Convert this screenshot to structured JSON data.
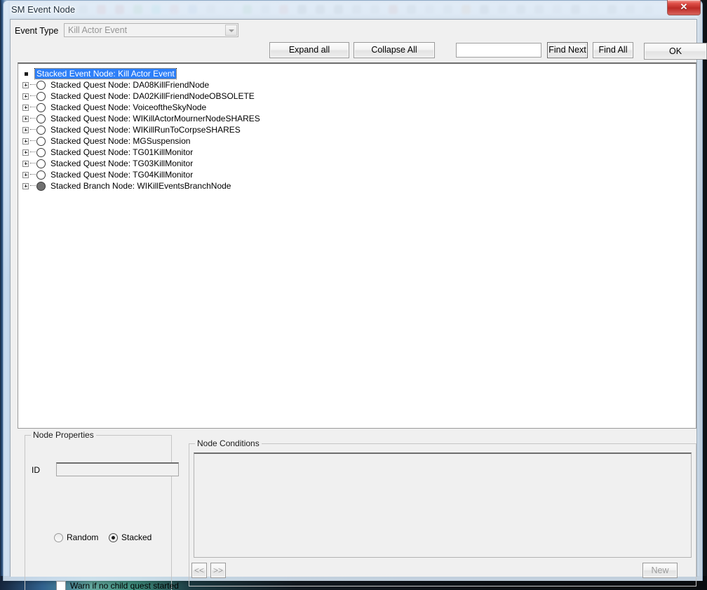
{
  "window": {
    "title": "SM Event Node",
    "close_label": "✕"
  },
  "toolbar": {
    "event_type_label": "Event Type",
    "event_type_value": "Kill Actor Event",
    "expand_all_label": "Expand all",
    "collapse_all_label": "Collapse All",
    "find_input_value": "",
    "find_input_placeholder": "",
    "find_next_label": "Find Next",
    "find_all_label": "Find All",
    "ok_label": "OK"
  },
  "tree": {
    "rows": [
      {
        "label": "Stacked Event Node: Kill Actor Event",
        "kind": "root",
        "selected": true
      },
      {
        "label": "Stacked Quest Node: DA08KillFriendNode",
        "kind": "quest",
        "selected": false
      },
      {
        "label": "Stacked Quest Node: DA02KillFriendNodeOBSOLETE",
        "kind": "quest",
        "selected": false
      },
      {
        "label": "Stacked Quest Node: VoiceoftheSkyNode",
        "kind": "quest",
        "selected": false
      },
      {
        "label": "Stacked Quest Node: WIKillActorMournerNodeSHARES",
        "kind": "quest",
        "selected": false
      },
      {
        "label": "Stacked Quest Node: WIKillRunToCorpseSHARES",
        "kind": "quest",
        "selected": false
      },
      {
        "label": "Stacked Quest Node: MGSuspension",
        "kind": "quest",
        "selected": false
      },
      {
        "label": "Stacked Quest Node: TG01KillMonitor",
        "kind": "quest",
        "selected": false
      },
      {
        "label": "Stacked Quest Node: TG03KillMonitor",
        "kind": "quest",
        "selected": false
      },
      {
        "label": "Stacked Quest Node: TG04KillMonitor",
        "kind": "quest",
        "selected": false
      },
      {
        "label": "Stacked Branch Node: WIKillEventsBranchNode",
        "kind": "branch",
        "selected": false
      }
    ]
  },
  "node_properties": {
    "title": "Node Properties",
    "id_label": "ID",
    "id_value": "",
    "random_label": "Random",
    "stacked_label": "Stacked",
    "warn_label": "Warn if no child quest started"
  },
  "node_conditions": {
    "title": "Node Conditions",
    "prev_label": "<<",
    "next_label": ">>",
    "new_label": "New"
  },
  "background_icons": [
    "#8d99a6",
    "#c43a3a",
    "#a83030",
    "#3f9f4a",
    "#2fc0b8",
    "#d06a6a",
    "#5a86c0",
    "#9aa6b2",
    "#b9c2cc",
    "#3f9f56",
    "#8fa3b5",
    "#c95a5a",
    "#4a5560",
    "#555f6a",
    "#4f5a66",
    "#7d8792",
    "#8d97a2",
    "#b3472f",
    "#6d7782",
    "#98a2ad",
    "#8a94a0",
    "#c2772f",
    "#56606b",
    "#8f99a4",
    "#6b7580",
    "#7a848f",
    "#9aa4af",
    "#5e6873",
    "#afb8c2",
    "#6f7983",
    "#8b949f",
    "#a4adb7"
  ]
}
